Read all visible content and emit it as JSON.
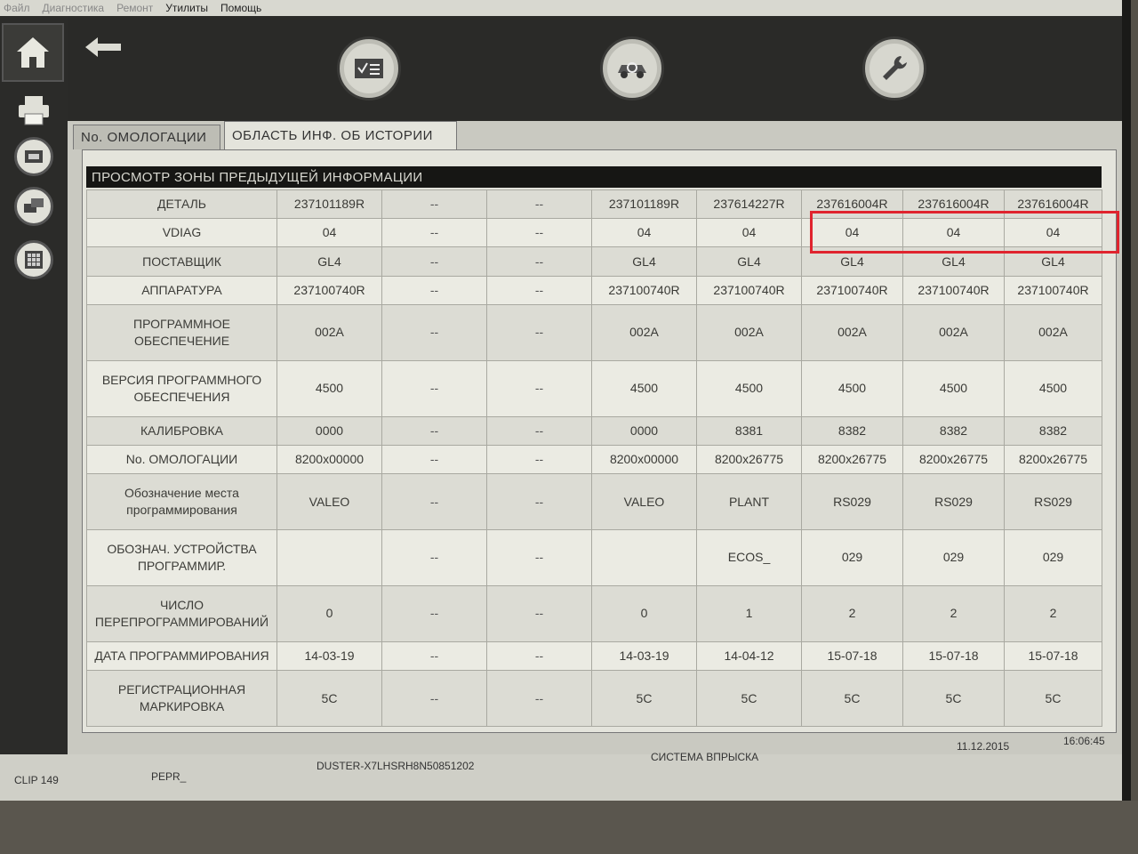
{
  "menu": {
    "items": [
      "Файл",
      "Диагностика",
      "Ремонт",
      "Утилиты",
      "Помощь"
    ]
  },
  "tabs": [
    {
      "label": "No. ОМОЛОГАЦИИ",
      "active": false
    },
    {
      "label": "ОБЛАСТЬ ИНФ. ОБ ИСТОРИИ",
      "active": true
    }
  ],
  "panel": {
    "title": "ПРОСМОТР ЗОНЫ ПРЕДЫДУЩЕЙ ИНФОРМАЦИИ"
  },
  "table": {
    "rows": [
      {
        "label": "ДЕТАЛЬ",
        "values": [
          "237101189R",
          "--",
          "--",
          "237101189R",
          "237614227R",
          "237616004R",
          "237616004R",
          "237616004R"
        ]
      },
      {
        "label": "VDIAG",
        "values": [
          "04",
          "--",
          "--",
          "04",
          "04",
          "04",
          "04",
          "04"
        ]
      },
      {
        "label": "ПОСТАВЩИК",
        "values": [
          "GL4",
          "--",
          "--",
          "GL4",
          "GL4",
          "GL4",
          "GL4",
          "GL4"
        ]
      },
      {
        "label": "АППАРАТУРА",
        "values": [
          "237100740R",
          "--",
          "--",
          "237100740R",
          "237100740R",
          "237100740R",
          "237100740R",
          "237100740R"
        ]
      },
      {
        "label": "ПРОГРАММНОЕ ОБЕСПЕЧЕНИЕ",
        "values": [
          "002A",
          "--",
          "--",
          "002A",
          "002A",
          "002A",
          "002A",
          "002A"
        ]
      },
      {
        "label": "ВЕРСИЯ ПРОГРАММНОГО ОБЕСПЕЧЕНИЯ",
        "values": [
          "4500",
          "--",
          "--",
          "4500",
          "4500",
          "4500",
          "4500",
          "4500"
        ]
      },
      {
        "label": "КАЛИБРОВКА",
        "values": [
          "0000",
          "--",
          "--",
          "0000",
          "8381",
          "8382",
          "8382",
          "8382"
        ]
      },
      {
        "label": "No. ОМОЛОГАЦИИ",
        "values": [
          "8200x00000",
          "--",
          "--",
          "8200x00000",
          "8200x26775",
          "8200x26775",
          "8200x26775",
          "8200x26775"
        ]
      },
      {
        "label": "Обозначение места программирования",
        "values": [
          "VALEO",
          "--",
          "--",
          "VALEO",
          "PLANT",
          "RS029",
          "RS029",
          "RS029"
        ]
      },
      {
        "label": "ОБОЗНАЧ. УСТРОЙСТВА ПРОГРАММИР.",
        "values": [
          "",
          "--",
          "--",
          "",
          "ECOS_",
          "029",
          "029",
          "029"
        ]
      },
      {
        "label": "ЧИСЛО ПЕРЕПРОГРАММИРОВАНИЙ",
        "values": [
          "0",
          "--",
          "--",
          "0",
          "1",
          "2",
          "2",
          "2"
        ]
      },
      {
        "label": "ДАТА ПРОГРАММИРОВАНИЯ",
        "values": [
          "14-03-19",
          "--",
          "--",
          "14-03-19",
          "14-04-12",
          "15-07-18",
          "15-07-18",
          "15-07-18"
        ]
      },
      {
        "label": "РЕГИСТРАЦИОННАЯ МАРКИРОВКА",
        "values": [
          "5C",
          "--",
          "--",
          "5C",
          "5C",
          "5C",
          "5C",
          "5C"
        ]
      }
    ]
  },
  "status": {
    "app_version": "CLIP 149",
    "field2": "PEPR_",
    "vehicle": "DUSTER-X7LHSRH8N50851202",
    "system": "СИСТЕМА ВПРЫСКА",
    "date": "11.12.2015",
    "time": "16:06:45"
  },
  "colors": {
    "highlight": "#e0242e",
    "panel_title_bg": "#161614"
  },
  "icons": {
    "home": "home-icon",
    "back": "back-arrow-icon",
    "printer": "printer-icon",
    "tool1": "checklist-icon",
    "tool2": "vehicle-diagnostic-icon",
    "tool3": "wrench-icon"
  }
}
